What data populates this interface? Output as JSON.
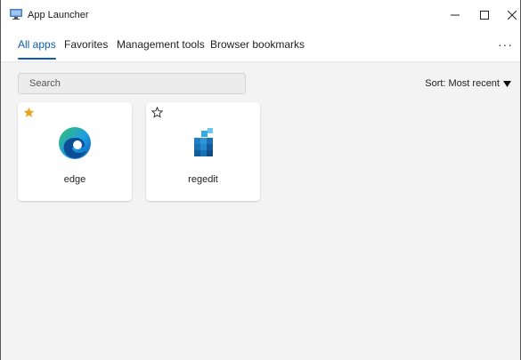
{
  "window": {
    "title": "App Launcher",
    "controls": [
      "minimize",
      "maximize",
      "close"
    ]
  },
  "tabs": [
    {
      "label": "All apps",
      "active": true
    },
    {
      "label": "Favorites",
      "active": false
    },
    {
      "label": "Management tools",
      "active": false
    },
    {
      "label": "Browser bookmarks",
      "active": false
    }
  ],
  "more_label": "···",
  "search": {
    "placeholder": "Search",
    "value": ""
  },
  "sort": {
    "label": "Sort: Most recent"
  },
  "apps": [
    {
      "name": "edge",
      "favorite": true,
      "icon": "edge-icon"
    },
    {
      "name": "regedit",
      "favorite": false,
      "icon": "regedit-icon"
    }
  ],
  "colors": {
    "accent": "#0f5ea8",
    "favorite_star": "#e8a317"
  }
}
